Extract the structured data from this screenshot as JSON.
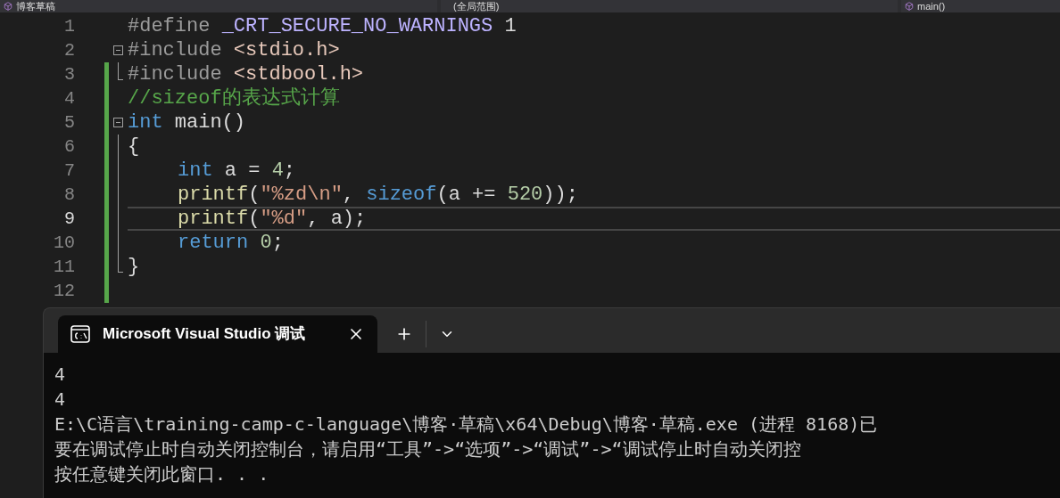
{
  "navigation_bar": {
    "project": "博客草稿",
    "scope": "(全局范围)",
    "member": "main()"
  },
  "editor": {
    "lines": [
      {
        "number": "1",
        "current": false,
        "changed": false,
        "indented": false,
        "tokens": [
          {
            "kind": "directive",
            "text": "#define "
          },
          {
            "kind": "macro",
            "text": "_CRT_SECURE_NO_WARNINGS"
          },
          {
            "kind": "plain",
            "text": " 1"
          }
        ]
      },
      {
        "number": "2",
        "current": false,
        "changed": false,
        "indented": false,
        "kind": "fold-start",
        "tokens": [
          {
            "kind": "directive",
            "text": "#include "
          },
          {
            "kind": "header",
            "text": "<stdio.h>"
          }
        ]
      },
      {
        "number": "3",
        "current": false,
        "changed": true,
        "indented": false,
        "kind": "fold-end",
        "tokens": [
          {
            "kind": "directive",
            "text": "#include "
          },
          {
            "kind": "header",
            "text": "<stdbool.h>"
          }
        ]
      },
      {
        "number": "4",
        "current": false,
        "changed": true,
        "indented": false,
        "kind": "plain",
        "tokens": [
          {
            "kind": "comment",
            "text": "//sizeof的表达式计算"
          }
        ]
      },
      {
        "number": "5",
        "current": false,
        "changed": true,
        "indented": false,
        "kind": "fold-start",
        "tokens": [
          {
            "kind": "keyword",
            "text": "int"
          },
          {
            "kind": "plain",
            "text": " main()"
          }
        ]
      },
      {
        "number": "6",
        "current": false,
        "changed": true,
        "indented": false,
        "kind": "fold-inside",
        "tokens": [
          {
            "kind": "plain",
            "text": "{"
          }
        ]
      },
      {
        "number": "7",
        "current": false,
        "changed": true,
        "indented": true,
        "kind": "fold-inside",
        "tokens": [
          {
            "kind": "keyword",
            "text": "int"
          },
          {
            "kind": "plain",
            "text": " a = "
          },
          {
            "kind": "number",
            "text": "4"
          },
          {
            "kind": "plain",
            "text": ";"
          }
        ]
      },
      {
        "number": "8",
        "current": false,
        "changed": true,
        "indented": true,
        "kind": "fold-inside",
        "tokens": [
          {
            "kind": "function",
            "text": "printf"
          },
          {
            "kind": "plain",
            "text": "("
          },
          {
            "kind": "string",
            "text": "\"%zd\\n\""
          },
          {
            "kind": "plain",
            "text": ", "
          },
          {
            "kind": "keyword",
            "text": "sizeof"
          },
          {
            "kind": "plain",
            "text": "(a += "
          },
          {
            "kind": "number",
            "text": "520"
          },
          {
            "kind": "plain",
            "text": "));"
          }
        ]
      },
      {
        "number": "9",
        "current": true,
        "changed": true,
        "indented": true,
        "kind": "fold-inside",
        "tokens": [
          {
            "kind": "function",
            "text": "printf"
          },
          {
            "kind": "plain",
            "text": "("
          },
          {
            "kind": "string",
            "text": "\"%d\""
          },
          {
            "kind": "plain",
            "text": ", a);"
          }
        ]
      },
      {
        "number": "10",
        "current": false,
        "changed": true,
        "indented": true,
        "kind": "fold-inside",
        "tokens": [
          {
            "kind": "keyword",
            "text": "return "
          },
          {
            "kind": "number",
            "text": "0"
          },
          {
            "kind": "plain",
            "text": ";"
          }
        ]
      },
      {
        "number": "11",
        "current": false,
        "changed": true,
        "indented": false,
        "kind": "fold-end",
        "tokens": [
          {
            "kind": "plain",
            "text": "}"
          }
        ]
      },
      {
        "number": "12",
        "current": false,
        "changed": true,
        "indented": false,
        "kind": "plain"
      }
    ]
  },
  "terminal": {
    "tab_title": "Microsoft Visual Studio 调试",
    "output": [
      "4",
      "4",
      "E:\\C语言\\training-camp-c-language\\博客·草稿\\x64\\Debug\\博客·草稿.exe (进程 8168)已",
      "要在调试停止时自动关闭控制台，请启用“工具”->“选项”->“调试”->“调试停止时自动关闭控",
      "按任意键关闭此窗口. . ."
    ]
  }
}
